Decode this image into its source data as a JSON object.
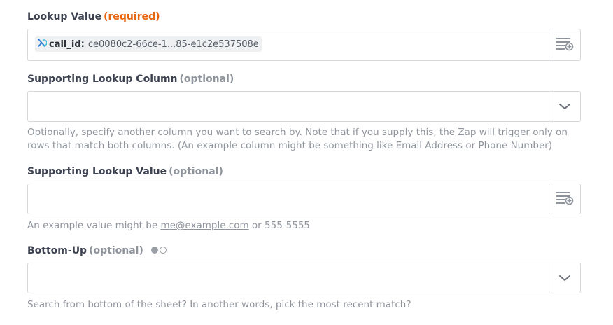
{
  "lookup_value": {
    "label": "Lookup Value",
    "tag": "(required)",
    "chip": {
      "icon": "zapier-step-icon",
      "name": "call_id:",
      "value": "ce0080c2-66ce-1...85-e1c2e537508e"
    },
    "side_icon": "insert-data-icon"
  },
  "supporting_lookup_column": {
    "label": "Supporting Lookup Column",
    "tag": "(optional)",
    "value": "",
    "side_icon": "chevron-down-icon",
    "help": "Optionally, specify another column you want to search by. Note that if you supply this, the Zap will trigger only on rows that match both columns. (An example column might be something like Email Address or Phone Number)"
  },
  "supporting_lookup_value": {
    "label": "Supporting Lookup Value",
    "tag": "(optional)",
    "value": "",
    "side_icon": "insert-data-icon",
    "help_prefix": "An example value might be",
    "help_link": "me@example.com",
    "help_suffix": "or 555-5555"
  },
  "bottom_up": {
    "label": "Bottom-Up",
    "tag": "(optional)",
    "toggle_icon": "boolean-toggle-icon",
    "value": "",
    "side_icon": "chevron-down-icon",
    "help": "Search from bottom of the sheet? In another words, pick the most recent match?"
  },
  "colors": {
    "required": "#e8640c",
    "optional": "#8f949c",
    "label": "#3d4250",
    "border": "#d6d8db"
  }
}
